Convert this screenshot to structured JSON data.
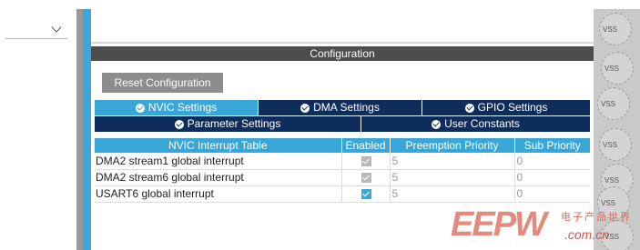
{
  "left_dropdown": {
    "value": ""
  },
  "panel": {
    "title": "Configuration",
    "reset_button": "Reset Configuration"
  },
  "tabs": {
    "row1": [
      {
        "label": "NVIC Settings",
        "active": true
      },
      {
        "label": "DMA Settings",
        "active": false
      },
      {
        "label": "GPIO Settings",
        "active": false
      }
    ],
    "row2": [
      {
        "label": "Parameter Settings",
        "active": false
      },
      {
        "label": "User Constants",
        "active": false
      }
    ]
  },
  "table": {
    "headers": [
      "NVIC Interrupt Table",
      "Enabled",
      "Preemption Priority",
      "Sub Priority"
    ],
    "rows": [
      {
        "name": "DMA2 stream1 global interrupt",
        "enabled": true,
        "editable": false,
        "preemption": "5",
        "sub": "0"
      },
      {
        "name": "DMA2 stream6 global interrupt",
        "enabled": true,
        "editable": false,
        "preemption": "5",
        "sub": "0"
      },
      {
        "name": "USART6 global interrupt",
        "enabled": true,
        "editable": true,
        "preemption": "5",
        "sub": "0"
      }
    ]
  },
  "pins": [
    "VSS",
    "VSS",
    "VSS",
    "VSS",
    "VSS",
    "VSS",
    "VSS"
  ],
  "watermark": {
    "logo": "EEPW",
    "tagline": "电子产品世界",
    "url": ".com.cn"
  },
  "colors": {
    "accent": "#39a6d8",
    "tab_dark": "#0f2d5a",
    "header_dark": "#4d4d4d"
  }
}
